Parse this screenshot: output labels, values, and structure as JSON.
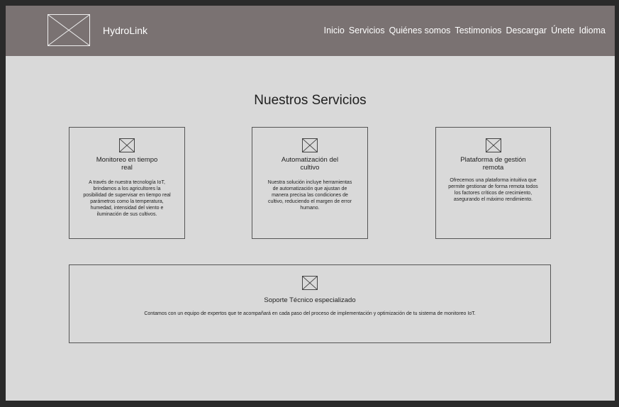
{
  "header": {
    "brand": "HydroLink",
    "nav": [
      "Inicio",
      "Servicios",
      "Quiénes somos",
      "Testimonios",
      "Descargar",
      "Únete",
      "Idioma"
    ]
  },
  "services": {
    "title": "Nuestros Servicios",
    "cards": [
      {
        "title": "Monitoreo en tiempo real",
        "text": "A través de nuestra tecnología IoT, brindamos a los agricultores la posibilidad de supervisar en tiempo real parámetros como la temperatura, humedad, intensidad del viento e iluminación de sus cultivos."
      },
      {
        "title": "Automatización del cultivo",
        "text": "Nuestra solución incluye herramientas de automatización que ajustan de manera precisa las condiciones de cultivo, reduciendo el margen de error humano."
      },
      {
        "title": "Plataforma de gestión remota",
        "text": "Ofrecemos una plataforma intuitiva que permite gestionar de forma remota todos los factores críticos de crecimiento, asegurando el máximo rendimiento."
      },
      {
        "title": "Soporte Técnico especializado",
        "text": "Contamos con un equipo de expertos que te acompañará en cada paso del proceso de implementación y optimización de tu sistema de monitoreo IoT."
      }
    ]
  },
  "icons": {
    "logo": "image-placeholder-icon",
    "card": "image-placeholder-icon"
  }
}
